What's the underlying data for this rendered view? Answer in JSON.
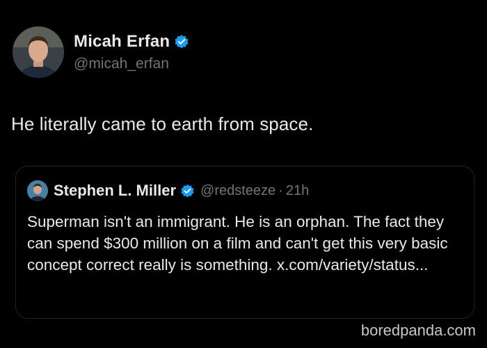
{
  "author": {
    "display_name": "Micah Erfan",
    "handle": "@micah_erfan",
    "verified": true
  },
  "tweet": {
    "text": "He literally came to earth from space."
  },
  "quoted_tweet": {
    "display_name": "Stephen L. Miller",
    "handle": "@redsteeze",
    "separator": "·",
    "time": "21h",
    "verified": true,
    "text": "Superman isn't an immigrant. He is an orphan. The fact they can spend $300 million on a film and can't get this very basic concept correct really is something. x.com/variety/status..."
  },
  "watermark": "boredpanda.com",
  "colors": {
    "background": "#000000",
    "text": "#e7e9ea",
    "secondary_text": "#71767b",
    "verified_badge": "#1d9bf0",
    "quote_border": "#1f2225"
  }
}
